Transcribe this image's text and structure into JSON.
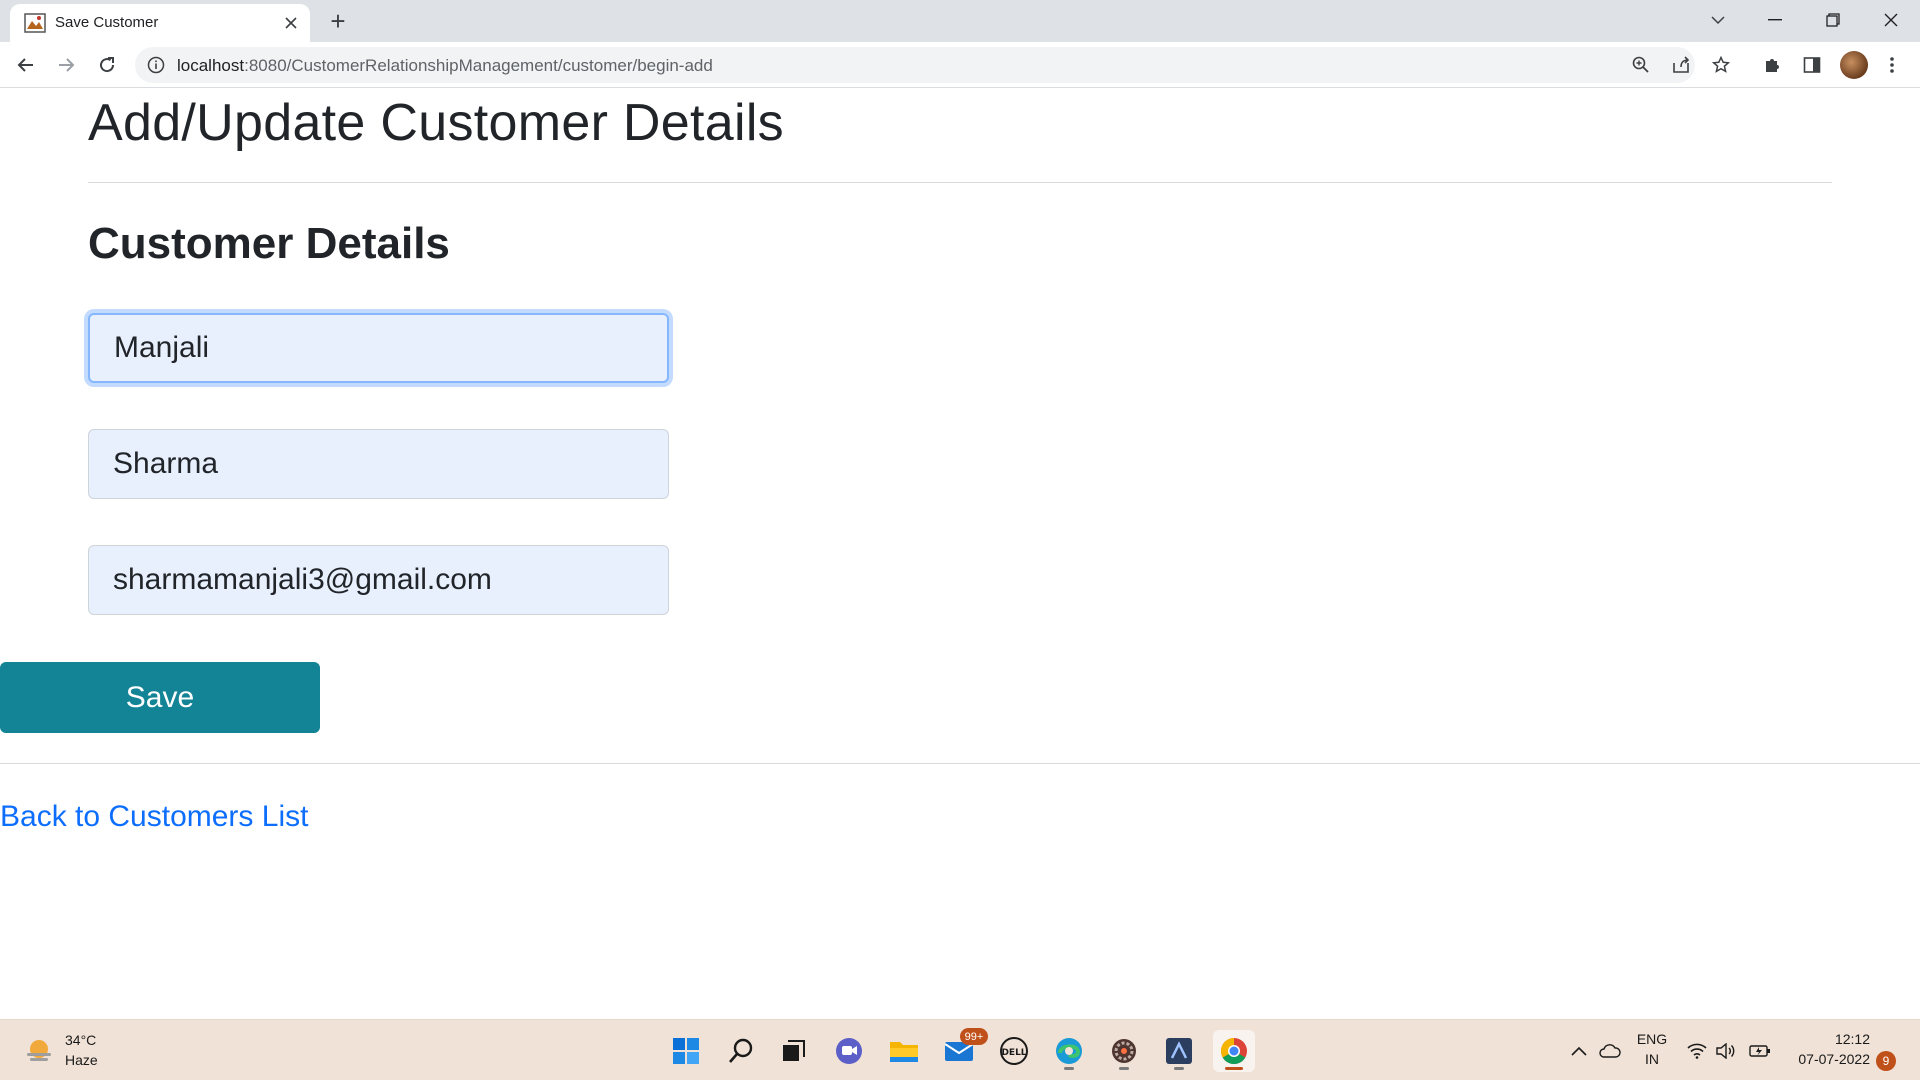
{
  "browser": {
    "tab_title": "Save Customer",
    "new_tab_symbol": "+",
    "url_host": "localhost",
    "url_path": ":8080/CustomerRelationshipManagement/customer/begin-add"
  },
  "page": {
    "heading": "Add/Update Customer Details",
    "subheading": "Customer Details",
    "form": {
      "first_name_value": "Manjali",
      "last_name_value": "Sharma",
      "email_value": "sharmamanjali3@gmail.com"
    },
    "save_label": "Save",
    "back_link_label": "Back to Customers List"
  },
  "taskbar": {
    "weather_temp": "34°C",
    "weather_condition": "Haze",
    "mail_badge": "99+",
    "language_line1": "ENG",
    "language_line2": "IN",
    "time": "12:12",
    "date": "07-07-2022",
    "notification_count": "9"
  },
  "colors": {
    "accent_button": "#138496",
    "link": "#0d6efd",
    "input_bg": "#e8f0fe"
  }
}
